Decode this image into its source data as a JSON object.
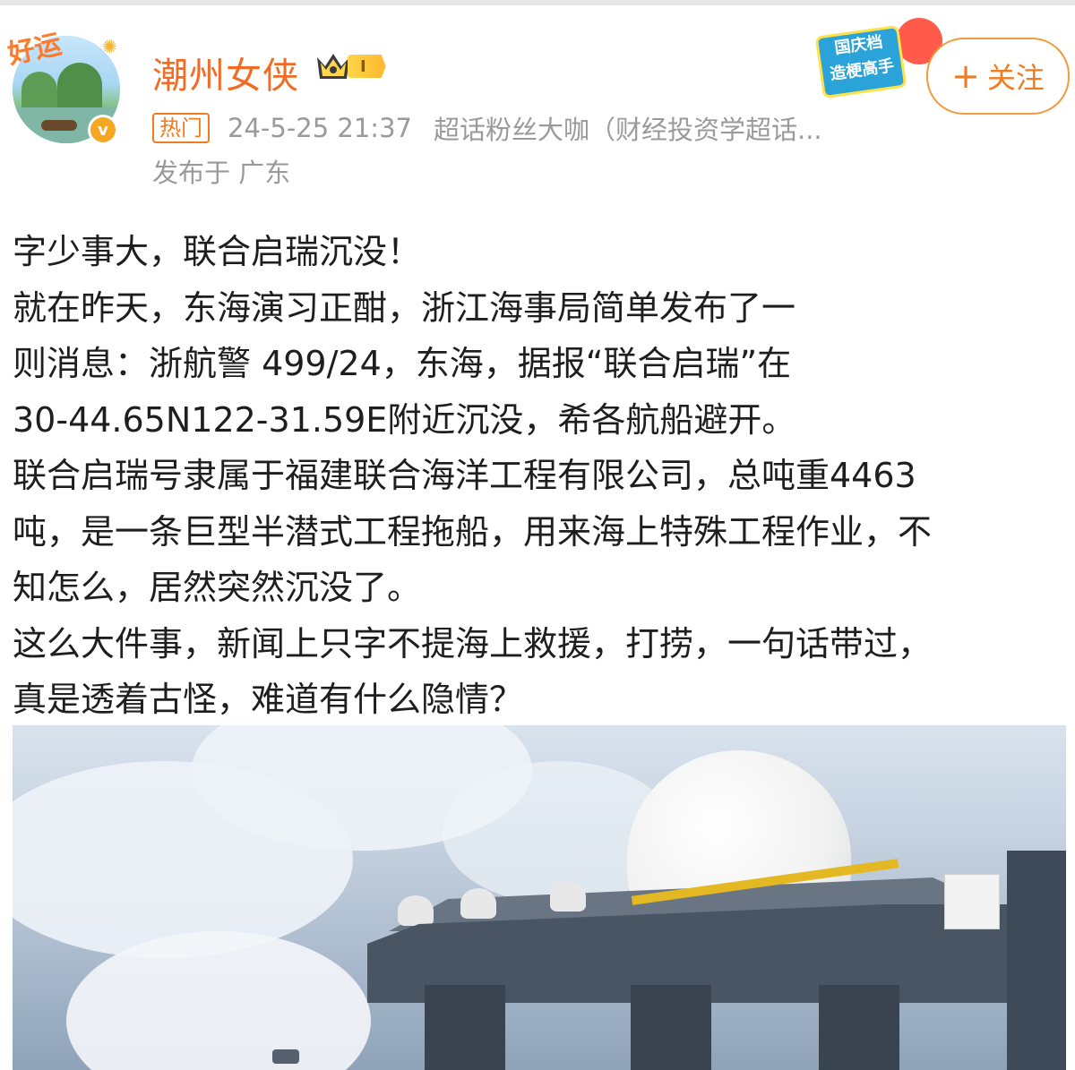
{
  "post": {
    "author": {
      "name": "潮州女侠",
      "avatar_overlay_text": "好运",
      "verified_badge": "v",
      "level_tag": "I"
    },
    "follow_button": {
      "label": "关注",
      "icon": "plus-icon"
    },
    "festival_badge": "国庆档\n造梗高手",
    "meta": {
      "hot_tag": "热门",
      "time": "24-5-25 21:37",
      "group": "超话粉丝大咖（财经投资学超话...",
      "location": "发布于 广东"
    },
    "body_lines": [
      "字少事大，联合启瑞沉没！",
      "就在昨天，东海演习正酣，浙江海事局简单发布了一",
      "则消息：浙航警 499/24，东海，据报“联合启瑞”在",
      "30-44.65N122-31.59E附近沉没，希各航船避开。",
      "联合启瑞号隶属于福建联合海洋工程有限公司，总吨重4463",
      "吨，是一条巨型半潜式工程拖船，用来海上特殊工程作业，不",
      "知怎么，居然突然沉没了。",
      "这么大件事，新闻上只字不提海上救援，打捞，一句话带过，",
      "真是透着古怪，难道有什么隐情？"
    ]
  },
  "colors": {
    "accent": "#f07b20",
    "username": "#f26b22",
    "meta_gray": "#9a9a9a",
    "text": "#1e1e1e"
  }
}
